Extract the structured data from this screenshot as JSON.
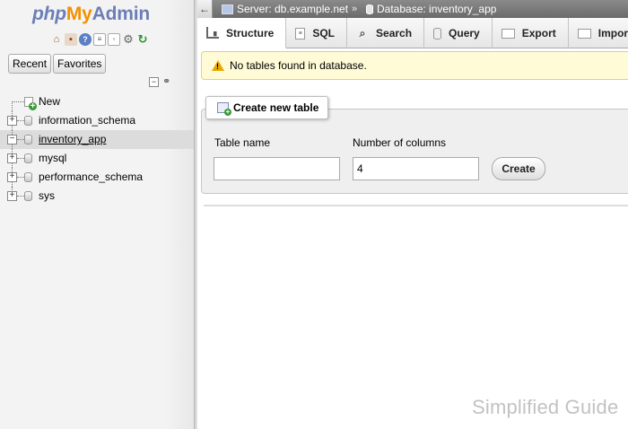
{
  "nav": {
    "logo": {
      "php": "php",
      "my": "My",
      "admin": "Admin"
    },
    "icons": [
      "home-icon",
      "logout-icon",
      "help-icon",
      "docs-icon",
      "copy-icon",
      "settings-gear-icon",
      "reload-icon"
    ],
    "tabs": {
      "recent": "Recent",
      "favorites": "Favorites"
    },
    "tree": [
      {
        "label": "New",
        "type": "new"
      },
      {
        "label": "information_schema",
        "type": "db"
      },
      {
        "label": "inventory_app",
        "type": "db",
        "active": true
      },
      {
        "label": "mysql",
        "type": "db"
      },
      {
        "label": "performance_schema",
        "type": "db"
      },
      {
        "label": "sys",
        "type": "db"
      }
    ]
  },
  "breadcrumb": {
    "server": "Server: db.example.net",
    "separator": "»",
    "database": "Database: inventory_app"
  },
  "tabs": [
    {
      "label": "Structure",
      "icon": "structure-icon",
      "active": true
    },
    {
      "label": "SQL",
      "icon": "sql-icon"
    },
    {
      "label": "Search",
      "icon": "search-icon"
    },
    {
      "label": "Query",
      "icon": "query-icon"
    },
    {
      "label": "Export",
      "icon": "export-icon"
    },
    {
      "label": "Import",
      "icon": "import-icon"
    }
  ],
  "notice": {
    "text": "No tables found in database."
  },
  "create_table": {
    "legend": "Create new table",
    "table_name_label": "Table name",
    "table_name_value": "",
    "columns_label": "Number of columns",
    "columns_value": "4",
    "button": "Create"
  },
  "watermark": "Simplified Guide",
  "colors": {
    "logo_blue": "#6c7eb7",
    "logo_orange": "#f29100",
    "notice_bg": "#fffbd6"
  }
}
